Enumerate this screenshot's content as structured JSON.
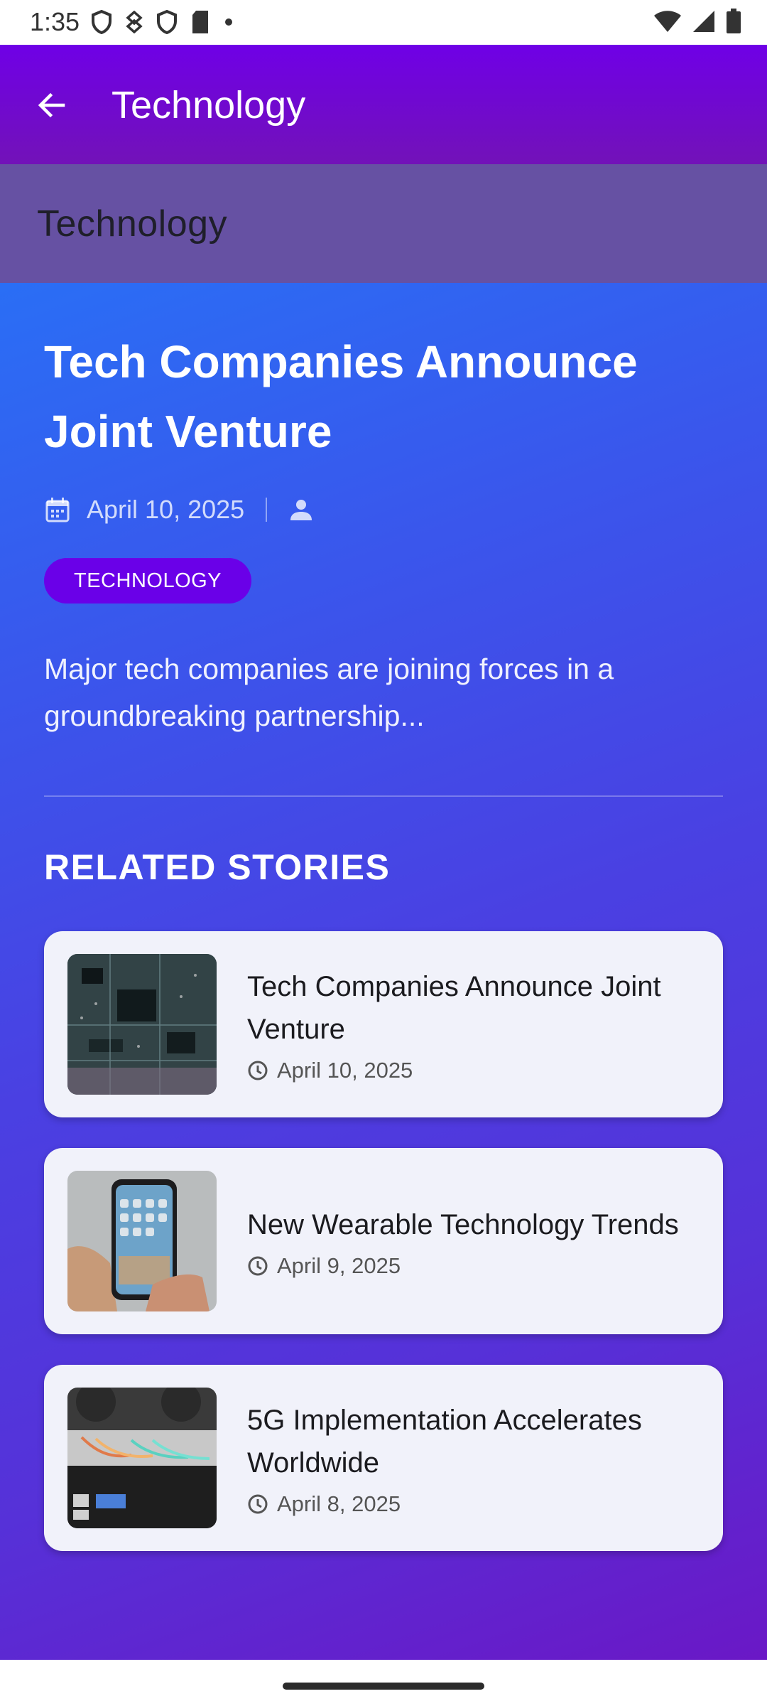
{
  "status_bar": {
    "time": "1:35",
    "left_icons": [
      "shield-icon",
      "vpn-key-icon",
      "shield-icon",
      "sd-card-icon",
      "dot-icon"
    ],
    "right_icons": [
      "wifi-icon",
      "signal-icon",
      "battery-icon"
    ]
  },
  "app_bar": {
    "title": "Technology"
  },
  "category_strip": {
    "title": "Technology"
  },
  "article": {
    "headline": "Tech Companies Announce Joint Venture",
    "date": "April 10, 2025",
    "author": "",
    "category": "TECHNOLOGY",
    "summary": "Major tech companies are joining forces in a groundbreaking partnership..."
  },
  "related": {
    "section_title": "RELATED STORIES",
    "stories": [
      {
        "title": "Tech Companies Announce Joint Venture",
        "date": "April 10, 2025",
        "thumb": "circuit-board-photo"
      },
      {
        "title": "New Wearable Technology Trends",
        "date": "April 9, 2025",
        "thumb": "smartphone-in-hand-photo"
      },
      {
        "title": "5G Implementation Accelerates Worldwide",
        "date": "April 8, 2025",
        "thumb": "network-switch-photo"
      }
    ]
  },
  "colors": {
    "app_bar": "#6f00e6",
    "category_strip": "#6651a3",
    "gradient_start": "#2a6ef5",
    "gradient_end": "#6a18c6",
    "chip": "#6a00e8",
    "card": "#f1f2fa"
  }
}
